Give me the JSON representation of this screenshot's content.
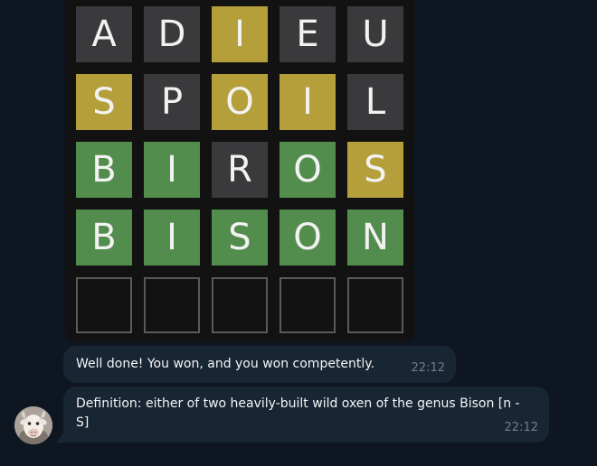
{
  "board": {
    "rows": [
      [
        {
          "letter": "A",
          "state": "absent"
        },
        {
          "letter": "D",
          "state": "absent"
        },
        {
          "letter": "I",
          "state": "present"
        },
        {
          "letter": "E",
          "state": "absent"
        },
        {
          "letter": "U",
          "state": "absent"
        }
      ],
      [
        {
          "letter": "S",
          "state": "present"
        },
        {
          "letter": "P",
          "state": "absent"
        },
        {
          "letter": "O",
          "state": "present"
        },
        {
          "letter": "I",
          "state": "present"
        },
        {
          "letter": "L",
          "state": "absent"
        }
      ],
      [
        {
          "letter": "B",
          "state": "correct"
        },
        {
          "letter": "I",
          "state": "correct"
        },
        {
          "letter": "R",
          "state": "absent"
        },
        {
          "letter": "O",
          "state": "correct"
        },
        {
          "letter": "S",
          "state": "present"
        }
      ],
      [
        {
          "letter": "B",
          "state": "correct"
        },
        {
          "letter": "I",
          "state": "correct"
        },
        {
          "letter": "S",
          "state": "correct"
        },
        {
          "letter": "O",
          "state": "correct"
        },
        {
          "letter": "N",
          "state": "correct"
        }
      ],
      [
        {
          "letter": "",
          "state": "empty"
        },
        {
          "letter": "",
          "state": "empty"
        },
        {
          "letter": "",
          "state": "empty"
        },
        {
          "letter": "",
          "state": "empty"
        },
        {
          "letter": "",
          "state": "empty"
        }
      ]
    ]
  },
  "messages": [
    {
      "text": "Well done! You won, and you won competently.",
      "time": "22:12"
    },
    {
      "text": "Definition: either of two heavily-built wild oxen of the genus Bison [n -S]",
      "time": "22:12"
    }
  ],
  "avatar": {
    "icon": "goat-avatar-icon"
  },
  "colors": {
    "background": "#0e1621",
    "bubble": "#182533",
    "absent": "#3a3a3c",
    "present": "#b59f3b",
    "correct": "#538d4e",
    "timestamp": "#6d7f8f"
  }
}
